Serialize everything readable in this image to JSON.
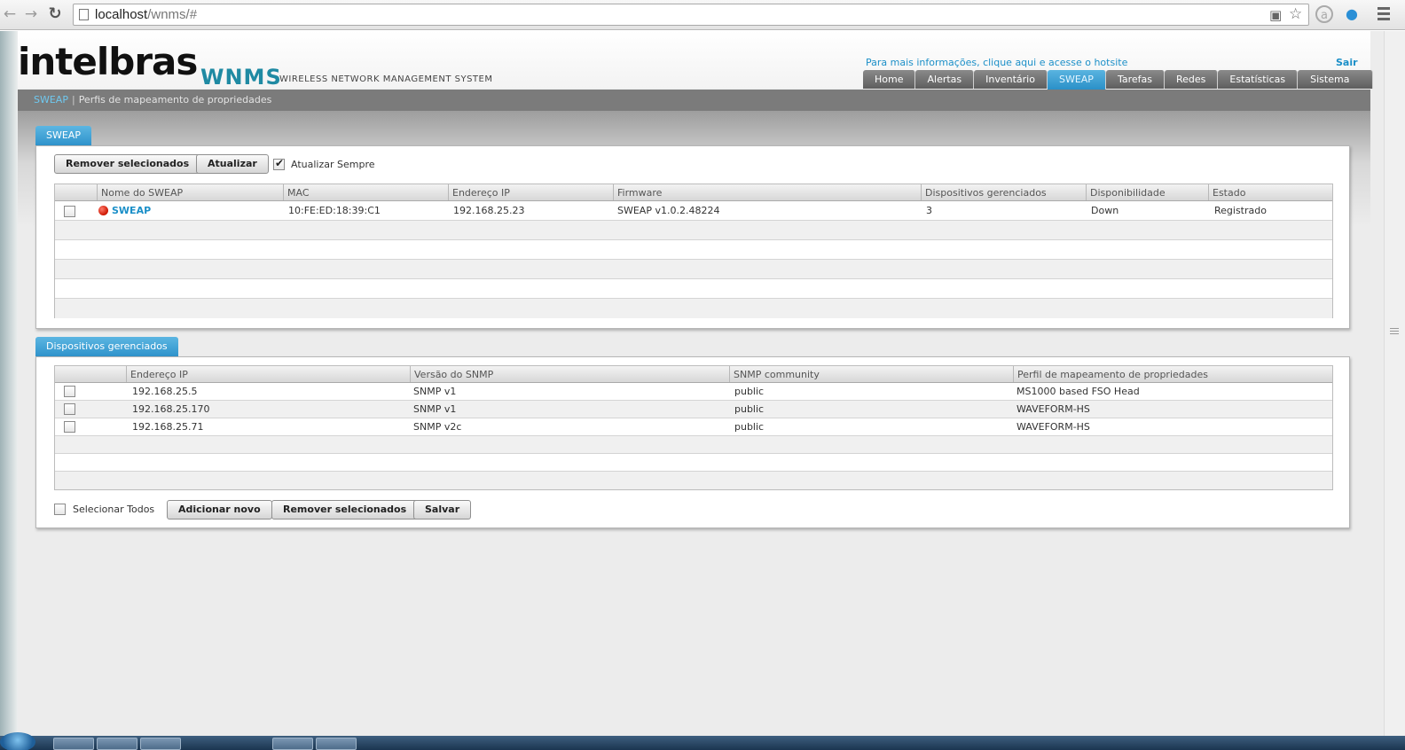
{
  "browser": {
    "url_host": "localhost",
    "url_path": "/wnms/#"
  },
  "header": {
    "logo": "intelbras",
    "product": "WNMS",
    "product_sub": "WIRELESS NETWORK MANAGEMENT SYSTEM",
    "hotsite_link": "Para mais informações, clique aqui e acesse o hotsite",
    "logout": "Sair"
  },
  "nav": {
    "tabs": [
      {
        "label": "Home"
      },
      {
        "label": "Alertas"
      },
      {
        "label": "Inventário"
      },
      {
        "label": "SWEAP",
        "active": true
      },
      {
        "label": "Tarefas"
      },
      {
        "label": "Redes"
      },
      {
        "label": "Estatísticas"
      },
      {
        "label": "Sistema"
      }
    ]
  },
  "breadcrumb": {
    "root": "SWEAP",
    "separator": "|",
    "current": "Perfis de mapeamento de propriedades"
  },
  "sweap_panel": {
    "tab_label": "SWEAP",
    "remove_button": "Remover selecionados",
    "refresh_button": "Atualizar",
    "auto_refresh_label": "Atualizar Sempre",
    "auto_refresh_checked": true,
    "columns": [
      "Nome do SWEAP",
      "MAC",
      "Endereço IP",
      "Firmware",
      "Dispositivos gerenciados",
      "Disponibilidade",
      "Estado"
    ],
    "rows": [
      {
        "name": "SWEAP",
        "status_color": "#cc1500",
        "mac": "10:FE:ED:18:39:C1",
        "ip": "192.168.25.23",
        "firmware": "SWEAP v1.0.2.48224",
        "managed": "3",
        "availability": "Down",
        "state": "Registrado"
      }
    ]
  },
  "devices_panel": {
    "tab_label": "Dispositivos gerenciados",
    "columns": [
      "Endereço IP",
      "Versão do SNMP",
      "SNMP community",
      "Perfil de mapeamento de propriedades"
    ],
    "rows": [
      {
        "ip": "192.168.25.5",
        "snmp_version": "SNMP v1",
        "community": "public",
        "profile": "MS1000 based FSO Head"
      },
      {
        "ip": "192.168.25.170",
        "snmp_version": "SNMP v1",
        "community": "public",
        "profile": "WAVEFORM-HS"
      },
      {
        "ip": "192.168.25.71",
        "snmp_version": "SNMP v2c",
        "community": "public",
        "profile": "WAVEFORM-HS"
      }
    ],
    "select_all_label": "Selecionar Todos",
    "add_button": "Adicionar novo",
    "remove_button": "Remover selecionados",
    "save_button": "Salvar"
  },
  "colors": {
    "accent": "#2f93cb",
    "link": "#1b8fc8",
    "brand_wnms": "#1f8aa3",
    "tab_inactive": "#6e6e6e"
  }
}
